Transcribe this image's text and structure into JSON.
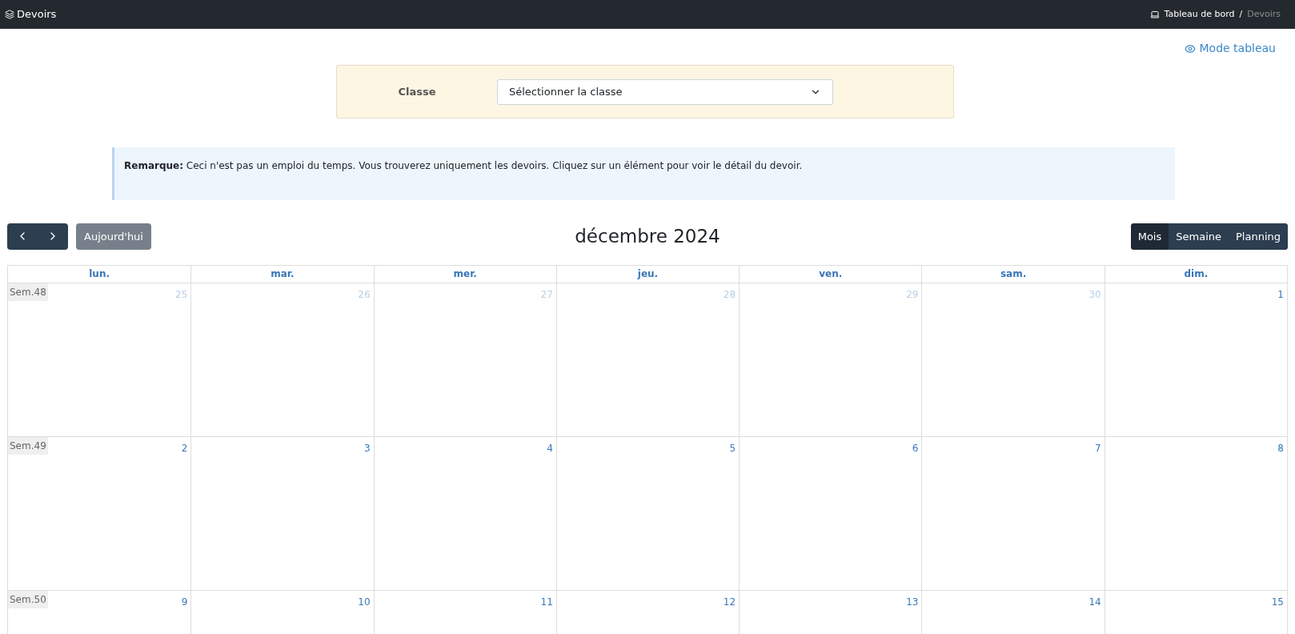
{
  "navbar": {
    "title": "Devoirs",
    "breadcrumb": [
      {
        "label": "Tableau de bord",
        "current": false
      },
      {
        "label": "Devoirs",
        "current": true
      }
    ],
    "separator": "/"
  },
  "mode_link": "Mode tableau",
  "filter": {
    "label": "Classe",
    "select_value": "Sélectionner la classe"
  },
  "remark": "**Remarque:** Ceci n'est pas un emploi du temps. Vous trouverez uniquement les devoirs. Cliquez sur un élément pour voir le détail du devoir.",
  "toolbar": {
    "today": "Aujourd'hui",
    "title": "décembre 2024",
    "views": [
      {
        "label": "Mois",
        "selected": true
      },
      {
        "label": "Semaine",
        "selected": false
      },
      {
        "label": "Planning",
        "selected": false
      }
    ]
  },
  "calendar": {
    "columns": [
      "lun.",
      "mar.",
      "mer.",
      "jeu.",
      "ven.",
      "sam.",
      "dim."
    ],
    "weeks": [
      {
        "label": "Sem.48",
        "days": [
          {
            "day": "25",
            "other_month": true
          },
          {
            "day": "26",
            "other_month": true
          },
          {
            "day": "27",
            "other_month": true
          },
          {
            "day": "28",
            "other_month": true
          },
          {
            "day": "29",
            "other_month": true
          },
          {
            "day": "30",
            "other_month": true
          },
          {
            "day": "1",
            "other_month": false
          }
        ]
      },
      {
        "label": "Sem.49",
        "days": [
          {
            "day": "2",
            "other_month": false
          },
          {
            "day": "3",
            "other_month": false
          },
          {
            "day": "4",
            "other_month": false
          },
          {
            "day": "5",
            "other_month": false
          },
          {
            "day": "6",
            "other_month": false
          },
          {
            "day": "7",
            "other_month": false
          },
          {
            "day": "8",
            "other_month": false
          }
        ]
      },
      {
        "label": "Sem.50",
        "days": [
          {
            "day": "9",
            "other_month": false
          },
          {
            "day": "10",
            "other_month": false
          },
          {
            "day": "11",
            "other_month": false
          },
          {
            "day": "12",
            "other_month": false
          },
          {
            "day": "13",
            "other_month": false
          },
          {
            "day": "14",
            "other_month": false
          },
          {
            "day": "15",
            "other_month": false
          }
        ]
      }
    ]
  }
}
